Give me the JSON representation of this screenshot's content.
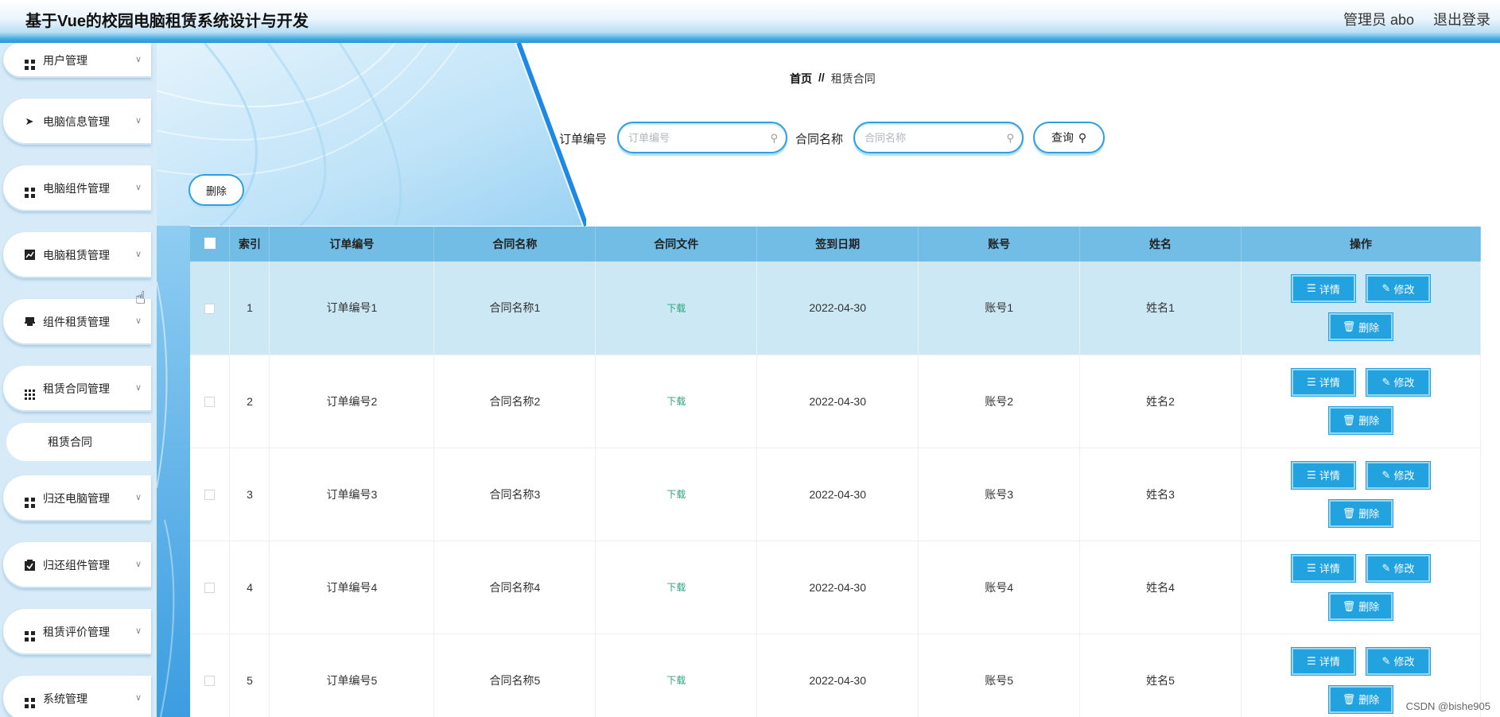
{
  "header": {
    "title": "基于Vue的校园电脑租赁系统设计与开发",
    "user": "管理员 abo",
    "logout": "退出登录"
  },
  "sidebar": {
    "items": [
      {
        "label": "用户管理",
        "icon": "grid-icon"
      },
      {
        "label": "电脑信息管理",
        "icon": "send-icon"
      },
      {
        "label": "电脑组件管理",
        "icon": "grid-icon"
      },
      {
        "label": "电脑租赁管理",
        "icon": "chart-icon"
      },
      {
        "label": "组件租赁管理",
        "icon": "printer-icon"
      },
      {
        "label": "租赁合同管理",
        "icon": "grid9-icon"
      },
      {
        "label": "归还电脑管理",
        "icon": "grid-icon"
      },
      {
        "label": "归还组件管理",
        "icon": "clipboard-check-icon"
      },
      {
        "label": "租赁评价管理",
        "icon": "grid-icon"
      },
      {
        "label": "系统管理",
        "icon": "grid-icon"
      }
    ],
    "active_sub": "租赁合同"
  },
  "breadcrumb": {
    "home": "首页",
    "sep": "//",
    "current": "租赁合同"
  },
  "search": {
    "order_label": "订单编号",
    "order_placeholder": "订单编号",
    "contract_label": "合同名称",
    "contract_placeholder": "合同名称",
    "query": "查询"
  },
  "actions": {
    "delete": "删除"
  },
  "table": {
    "headers": [
      "索引",
      "订单编号",
      "合同名称",
      "合同文件",
      "签到日期",
      "账号",
      "姓名",
      "操作"
    ],
    "rows": [
      {
        "idx": "1",
        "order": "订单编号1",
        "contract": "合同名称1",
        "file": "下载",
        "date": "2022-04-30",
        "account": "账号1",
        "name": "姓名1"
      },
      {
        "idx": "2",
        "order": "订单编号2",
        "contract": "合同名称2",
        "file": "下载",
        "date": "2022-04-30",
        "account": "账号2",
        "name": "姓名2"
      },
      {
        "idx": "3",
        "order": "订单编号3",
        "contract": "合同名称3",
        "file": "下载",
        "date": "2022-04-30",
        "account": "账号3",
        "name": "姓名3"
      },
      {
        "idx": "4",
        "order": "订单编号4",
        "contract": "合同名称4",
        "file": "下载",
        "date": "2022-04-30",
        "account": "账号4",
        "name": "姓名4"
      },
      {
        "idx": "5",
        "order": "订单编号5",
        "contract": "合同名称5",
        "file": "下载",
        "date": "2022-04-30",
        "account": "账号5",
        "name": "姓名5"
      }
    ],
    "ops": {
      "detail": "详情",
      "edit": "修改",
      "delete": "删除"
    }
  },
  "watermark": "CSDN @bishe905",
  "colors": {
    "accent": "#22a3e0",
    "header_row": "#72bde6",
    "highlight_row": "#cce8f5",
    "download": "#2fa37a"
  }
}
